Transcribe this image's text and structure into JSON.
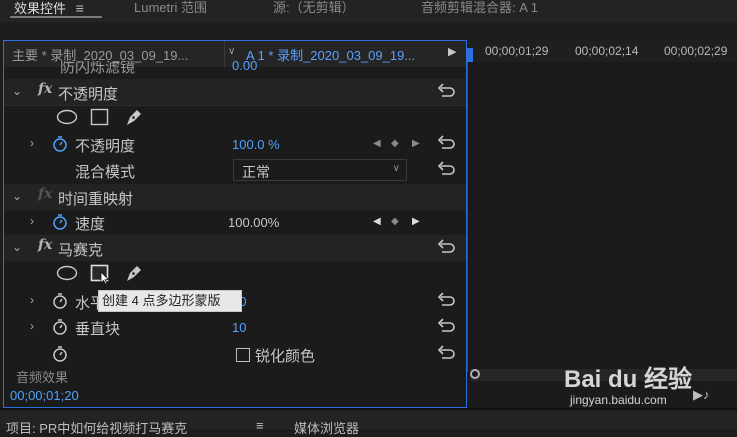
{
  "tabs": [
    {
      "label": "效果控件",
      "menu": "≡"
    },
    {
      "label": "Lumetri 范围"
    },
    {
      "label": "源:（无剪辑）"
    },
    {
      "label": "音频剪辑混合器: A 1"
    }
  ],
  "header": {
    "master": "主要 * 录制_2020_03_09_19...",
    "clip": "A 1 * 录制_2020_03_09_19...",
    "play": "▶"
  },
  "timeline": {
    "timecodes": [
      "00;00;01;29",
      "00;00;02;14",
      "00;00;02;29"
    ]
  },
  "partial_row": {
    "label": "防闪烁滤镜",
    "value": "0.00"
  },
  "opacity": {
    "section": "不透明度",
    "fx": "fx",
    "opacity_label": "不透明度",
    "opacity_value": "100.0 %",
    "blend_label": "混合模式",
    "blend_value": "正常"
  },
  "time_remap": {
    "section": "时间重映射",
    "fx": "fx",
    "speed_label": "速度",
    "speed_value": "100.00%"
  },
  "mosaic": {
    "section": "马赛克",
    "fx": "fx",
    "h_label": "水平块",
    "h_value": "10",
    "v_label": "垂直块",
    "v_value": "10",
    "sharpen_label": "锐化颜色",
    "tooltip": "创建 4 点多边形蒙版"
  },
  "audio_effects": "音频效果",
  "current_time": "00;00;01;20",
  "bottom_tabs": [
    "项目: PR中如何给视频打马赛克",
    "≡",
    "媒体浏览器"
  ],
  "watermark": {
    "brand": "Bai du 经验",
    "url": "jingyan.baidu.com"
  },
  "colors": {
    "accent": "#2d6fe0",
    "value_blue": "#4ea1ff"
  }
}
